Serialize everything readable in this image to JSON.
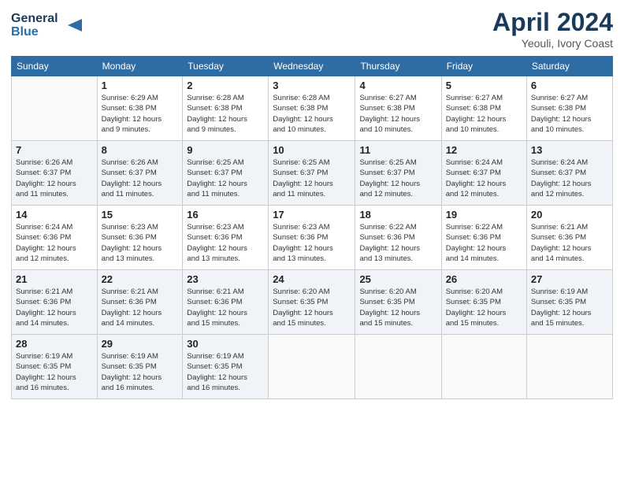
{
  "header": {
    "logo_line1": "General",
    "logo_line2": "Blue",
    "month_title": "April 2024",
    "location": "Yeouli, Ivory Coast"
  },
  "weekdays": [
    "Sunday",
    "Monday",
    "Tuesday",
    "Wednesday",
    "Thursday",
    "Friday",
    "Saturday"
  ],
  "weeks": [
    [
      {
        "day": "",
        "info": ""
      },
      {
        "day": "1",
        "info": "Sunrise: 6:29 AM\nSunset: 6:38 PM\nDaylight: 12 hours\nand 9 minutes."
      },
      {
        "day": "2",
        "info": "Sunrise: 6:28 AM\nSunset: 6:38 PM\nDaylight: 12 hours\nand 9 minutes."
      },
      {
        "day": "3",
        "info": "Sunrise: 6:28 AM\nSunset: 6:38 PM\nDaylight: 12 hours\nand 10 minutes."
      },
      {
        "day": "4",
        "info": "Sunrise: 6:27 AM\nSunset: 6:38 PM\nDaylight: 12 hours\nand 10 minutes."
      },
      {
        "day": "5",
        "info": "Sunrise: 6:27 AM\nSunset: 6:38 PM\nDaylight: 12 hours\nand 10 minutes."
      },
      {
        "day": "6",
        "info": "Sunrise: 6:27 AM\nSunset: 6:38 PM\nDaylight: 12 hours\nand 10 minutes."
      }
    ],
    [
      {
        "day": "7",
        "info": "Sunrise: 6:26 AM\nSunset: 6:37 PM\nDaylight: 12 hours\nand 11 minutes."
      },
      {
        "day": "8",
        "info": "Sunrise: 6:26 AM\nSunset: 6:37 PM\nDaylight: 12 hours\nand 11 minutes."
      },
      {
        "day": "9",
        "info": "Sunrise: 6:25 AM\nSunset: 6:37 PM\nDaylight: 12 hours\nand 11 minutes."
      },
      {
        "day": "10",
        "info": "Sunrise: 6:25 AM\nSunset: 6:37 PM\nDaylight: 12 hours\nand 11 minutes."
      },
      {
        "day": "11",
        "info": "Sunrise: 6:25 AM\nSunset: 6:37 PM\nDaylight: 12 hours\nand 12 minutes."
      },
      {
        "day": "12",
        "info": "Sunrise: 6:24 AM\nSunset: 6:37 PM\nDaylight: 12 hours\nand 12 minutes."
      },
      {
        "day": "13",
        "info": "Sunrise: 6:24 AM\nSunset: 6:37 PM\nDaylight: 12 hours\nand 12 minutes."
      }
    ],
    [
      {
        "day": "14",
        "info": "Sunrise: 6:24 AM\nSunset: 6:36 PM\nDaylight: 12 hours\nand 12 minutes."
      },
      {
        "day": "15",
        "info": "Sunrise: 6:23 AM\nSunset: 6:36 PM\nDaylight: 12 hours\nand 13 minutes."
      },
      {
        "day": "16",
        "info": "Sunrise: 6:23 AM\nSunset: 6:36 PM\nDaylight: 12 hours\nand 13 minutes."
      },
      {
        "day": "17",
        "info": "Sunrise: 6:23 AM\nSunset: 6:36 PM\nDaylight: 12 hours\nand 13 minutes."
      },
      {
        "day": "18",
        "info": "Sunrise: 6:22 AM\nSunset: 6:36 PM\nDaylight: 12 hours\nand 13 minutes."
      },
      {
        "day": "19",
        "info": "Sunrise: 6:22 AM\nSunset: 6:36 PM\nDaylight: 12 hours\nand 14 minutes."
      },
      {
        "day": "20",
        "info": "Sunrise: 6:21 AM\nSunset: 6:36 PM\nDaylight: 12 hours\nand 14 minutes."
      }
    ],
    [
      {
        "day": "21",
        "info": "Sunrise: 6:21 AM\nSunset: 6:36 PM\nDaylight: 12 hours\nand 14 minutes."
      },
      {
        "day": "22",
        "info": "Sunrise: 6:21 AM\nSunset: 6:36 PM\nDaylight: 12 hours\nand 14 minutes."
      },
      {
        "day": "23",
        "info": "Sunrise: 6:21 AM\nSunset: 6:36 PM\nDaylight: 12 hours\nand 15 minutes."
      },
      {
        "day": "24",
        "info": "Sunrise: 6:20 AM\nSunset: 6:35 PM\nDaylight: 12 hours\nand 15 minutes."
      },
      {
        "day": "25",
        "info": "Sunrise: 6:20 AM\nSunset: 6:35 PM\nDaylight: 12 hours\nand 15 minutes."
      },
      {
        "day": "26",
        "info": "Sunrise: 6:20 AM\nSunset: 6:35 PM\nDaylight: 12 hours\nand 15 minutes."
      },
      {
        "day": "27",
        "info": "Sunrise: 6:19 AM\nSunset: 6:35 PM\nDaylight: 12 hours\nand 15 minutes."
      }
    ],
    [
      {
        "day": "28",
        "info": "Sunrise: 6:19 AM\nSunset: 6:35 PM\nDaylight: 12 hours\nand 16 minutes."
      },
      {
        "day": "29",
        "info": "Sunrise: 6:19 AM\nSunset: 6:35 PM\nDaylight: 12 hours\nand 16 minutes."
      },
      {
        "day": "30",
        "info": "Sunrise: 6:19 AM\nSunset: 6:35 PM\nDaylight: 12 hours\nand 16 minutes."
      },
      {
        "day": "",
        "info": ""
      },
      {
        "day": "",
        "info": ""
      },
      {
        "day": "",
        "info": ""
      },
      {
        "day": "",
        "info": ""
      }
    ]
  ]
}
